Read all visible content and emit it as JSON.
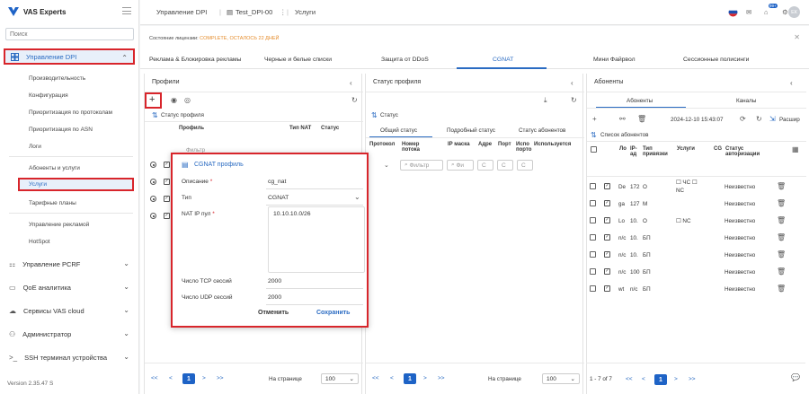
{
  "app": {
    "logo_text": "VAS Experts",
    "version": "Version 2.35.47 S"
  },
  "sidebar": {
    "search_placeholder": "Поиск",
    "groups": [
      {
        "label": "Управление DPI"
      },
      {
        "label": "Управление PCRF"
      },
      {
        "label": "QoE аналитика"
      },
      {
        "label": "Сервисы VAS cloud"
      },
      {
        "label": "Администратор"
      },
      {
        "label": "SSH терминал устройства"
      }
    ],
    "dpi_items": [
      {
        "label": "Производительность"
      },
      {
        "label": "Конфигурация"
      },
      {
        "label": "Приоритизация по протоколам"
      },
      {
        "label": "Приоритизация по ASN"
      },
      {
        "label": "Логи"
      },
      {
        "label": "Абоненты и услуги"
      },
      {
        "label": "Услуги"
      },
      {
        "label": "Тарифные планы"
      },
      {
        "label": "Управление рекламой"
      },
      {
        "label": "HotSpot"
      }
    ]
  },
  "topbar": {
    "crumb1": "Управление DPI",
    "crumb2": "Test_DPI-00",
    "crumb3": "Услуги",
    "badge": "99+",
    "avatar": "ЕК"
  },
  "license": {
    "label": "Состояние лицензии:",
    "value": "COMPLETE, ОСТАЛОСЬ 22 ДНЕЙ"
  },
  "tabs": [
    {
      "label": "Реклама & Блокировка рекламы"
    },
    {
      "label": "Черные и белые списки"
    },
    {
      "label": "Защита от DDoS"
    },
    {
      "label": "CGNAT"
    },
    {
      "label": "Мини Файрвол"
    },
    {
      "label": "Сессионные полисинги"
    }
  ],
  "profiles": {
    "title": "Профили",
    "status_link": "Статус профиля",
    "col_profile": "Профиль",
    "col_nat_type": "Тип NAT",
    "col_status": "Статус",
    "filter_placeholder": "Фильтр"
  },
  "profile_status": {
    "title": "Статус профиля",
    "status_link": "Статус",
    "subtabs": [
      {
        "label": "Общий статус"
      },
      {
        "label": "Подробный статус"
      },
      {
        "label": "Статус абонентов"
      }
    ],
    "cols": [
      {
        "label": "Протокол"
      },
      {
        "label": "Номер потока"
      },
      {
        "label": "IP маска"
      },
      {
        "label": "Адре"
      },
      {
        "label": "Порт"
      },
      {
        "label": "Испо порто"
      },
      {
        "label": "Используется"
      }
    ],
    "filter_placeholder": "Фильтр",
    "filter_short": "Фи",
    "filter_c": "С"
  },
  "subscribers": {
    "title": "Абоненты",
    "tab_subscribers": "Абоненты",
    "tab_channels": "Каналы",
    "timestamp": "2024-12-10 15:43:07",
    "expand_label": "Расшир",
    "list_link": "Список абонентов",
    "cols": [
      {
        "label": "Ло"
      },
      {
        "label": "IP-ад"
      },
      {
        "label": "Тип привязки"
      },
      {
        "label": "Услуги"
      },
      {
        "label": "CG"
      },
      {
        "label": "Статус авторизации"
      }
    ],
    "rows": [
      {
        "login": "De",
        "ip": "172",
        "bind": "O",
        "services": "ЧС",
        "services2": "NC",
        "auth": "Неизвестно"
      },
      {
        "login": "ga",
        "ip": "127",
        "bind": "М",
        "services": "",
        "services2": "",
        "auth": "Неизвестно"
      },
      {
        "login": "Lo",
        "ip": "10.",
        "bind": "O",
        "services": "NC",
        "services2": "",
        "auth": "Неизвестно"
      },
      {
        "login": "n/c",
        "ip": "10.",
        "bind": "БП",
        "services": "",
        "services2": "",
        "auth": "Неизвестно"
      },
      {
        "login": "n/c",
        "ip": "10.",
        "bind": "БП",
        "services": "",
        "services2": "",
        "auth": "Неизвестно"
      },
      {
        "login": "n/c",
        "ip": "100",
        "bind": "БП",
        "services": "",
        "services2": "",
        "auth": "Неизвестно"
      },
      {
        "login": "wt",
        "ip": "n/c",
        "bind": "БП",
        "services": "",
        "services2": "",
        "auth": "Неизвестно"
      }
    ],
    "range": "1 - 7 of 7"
  },
  "pager": {
    "first": "<<",
    "prev": "<",
    "page": "1",
    "next": ">",
    "last": ">>",
    "per_page_label": "На странице",
    "per_page": "100"
  },
  "dialog": {
    "title": "CGNAT профиль",
    "desc_label": "Описание",
    "desc_value": "cg_nat",
    "type_label": "Тип",
    "type_value": "CGNAT",
    "pool_label": "NAT IP пул",
    "pool_value": "10.10.10.0/26",
    "tcp_label": "Число TCP сессий",
    "tcp_value": "2000",
    "udp_label": "Число UDP сессий",
    "udp_value": "2000",
    "cancel": "Отменить",
    "save": "Сохранить",
    "required_mark": "*"
  },
  "colors": {
    "accent": "#2a6bc2",
    "highlight": "#d8252b",
    "license_value": "#e58c2b"
  }
}
